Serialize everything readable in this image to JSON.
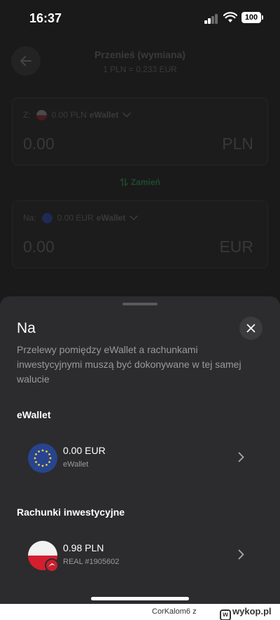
{
  "status_bar": {
    "time": "16:37",
    "battery": "100"
  },
  "header": {
    "title": "Przenieś (wymiana)",
    "rate": "1 PLN = 0.233 EUR"
  },
  "from_card": {
    "label": "Z:",
    "balance": "0.00 PLN",
    "wallet": "eWallet",
    "amount": "0.00",
    "currency": "PLN"
  },
  "swap": {
    "label": "Zamień"
  },
  "to_card": {
    "label": "Na:",
    "balance": "0.00 EUR",
    "wallet": "eWallet",
    "amount": "0.00",
    "currency": "EUR"
  },
  "sheet": {
    "title": "Na",
    "description": "Przelewy pomiędzy eWallet a rachunkami inwestycyjnymi muszą być dokonywane w tej samej walucie",
    "sections": [
      {
        "title": "eWallet",
        "items": [
          {
            "amount": "0.00 EUR",
            "subtitle": "eWallet",
            "icon": "eu-flag-icon"
          }
        ]
      },
      {
        "title": "Rachunki inwestycyjne",
        "items": [
          {
            "amount": "0.98 PLN",
            "subtitle": "REAL #1905602",
            "icon": "poland-flag-icon"
          }
        ]
      }
    ]
  },
  "footer": {
    "user": "CorKalom6",
    "separator": "z",
    "site": "wykop.pl"
  },
  "colors": {
    "background": "#1a1a1a",
    "sheet": "#2c2c2e",
    "accent_green": "#1e4a30",
    "pl_red": "#d41f2f",
    "eu_blue": "#28448f"
  }
}
